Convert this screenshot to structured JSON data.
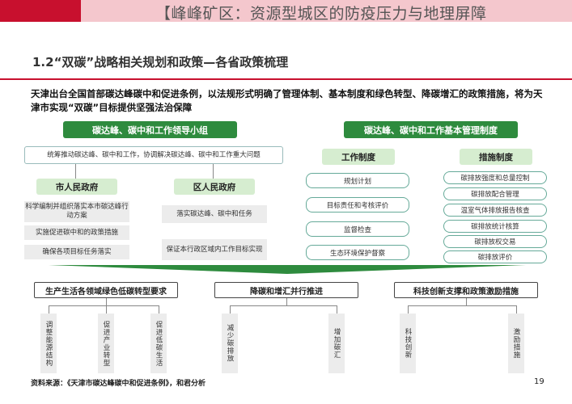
{
  "banner": {
    "title": "【峰峰矿区：资源型城区的防疫压力与地理屏障"
  },
  "section_title": "1.2“双碳”战略相关规划和政策—各省政策梳理",
  "headline": "天津出台全国首部碳达峰碳中和促进条例，以法规形式明确了管理体制、基本制度和绿色转型、降碳增汇的政策措施，将为天津市实现“双碳”目标提供坚强法治保障",
  "left": {
    "header": "碳达峰、碳中和工作领导小组",
    "coordinator": "统筹推动碳达峰、碳中和工作，协调解决碳达峰、碳中和工作重大问题",
    "city_gov": {
      "label": "市人民政府",
      "items": [
        "科学编制并组织落实本市碳达峰行动方案",
        "实施促进碳中和的政策措施",
        "确保各项目标任务落实"
      ]
    },
    "district_gov": {
      "label": "区人民政府",
      "items": [
        "落实碳达峰、碳中和任务",
        "保证本行政区域内工作目标实现"
      ]
    }
  },
  "right": {
    "header": "碳达峰、碳中和工作基本管理制度",
    "work_system": {
      "label": "工作制度",
      "items": [
        "规划计划",
        "目标责任和考核评价",
        "监督检查",
        "生态环境保护督察"
      ]
    },
    "measures": {
      "label": "措施制度",
      "items": [
        "碳排放强度和总量控制",
        "碳排放配合管理",
        "温室气体排放报告核查",
        "碳排放统计核算",
        "碳排放权交易",
        "碳排放评价"
      ]
    }
  },
  "bottom": {
    "groups": [
      {
        "label": "生产生活各领域绿色低碳转型要求",
        "items": [
          "调整能源结构",
          "促进产业转型",
          "促进低碳生活"
        ]
      },
      {
        "label": "降碳和增汇并行推进",
        "items": [
          "减少碳排放",
          "增加碳汇"
        ]
      },
      {
        "label": "科技创新支撑和政策激励措施",
        "items": [
          "科技创新",
          "激励措施"
        ]
      }
    ]
  },
  "source": "资料来源：《天津市碳达峰碳中和促进条例》，和君分析",
  "page_number": "19",
  "colors": {
    "brand_red": "#c8102e",
    "green": "#2e8b3e",
    "light_green": "#d6edd0"
  }
}
